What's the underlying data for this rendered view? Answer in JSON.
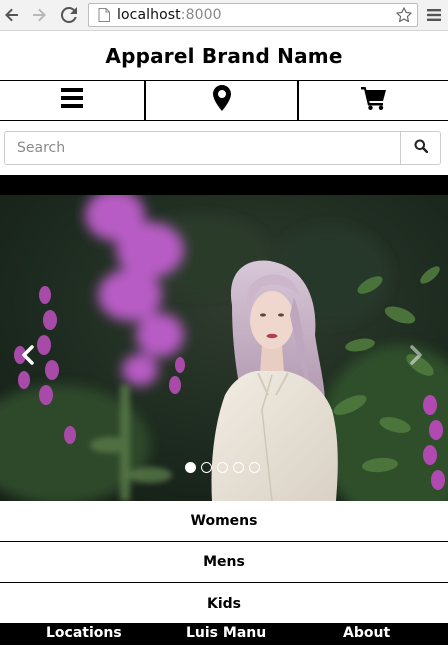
{
  "browser": {
    "url_host": "localhost",
    "url_port": ":8000",
    "icons": [
      "back-arrow-icon",
      "forward-arrow-icon",
      "reload-icon",
      "page-icon",
      "star-icon",
      "menu-icon"
    ]
  },
  "header": {
    "brand": "Apparel Brand Name"
  },
  "iconbar": {
    "icons": [
      "hamburger-menu-icon",
      "map-marker-icon",
      "shopping-cart-icon"
    ]
  },
  "search": {
    "placeholder": "Search",
    "value": ""
  },
  "carousel": {
    "slide_count": 5,
    "active_slide": 1,
    "image": "woman-in-flower-garden"
  },
  "categories": [
    {
      "label": "Womens"
    },
    {
      "label": "Mens"
    },
    {
      "label": "Kids"
    }
  ],
  "footer": {
    "links": [
      {
        "label": "Locations"
      },
      {
        "label": "Luis Manu"
      },
      {
        "label": "About"
      }
    ]
  },
  "colors": {
    "accent": "#000000",
    "background": "#ffffff",
    "footer_bg": "#000000"
  }
}
